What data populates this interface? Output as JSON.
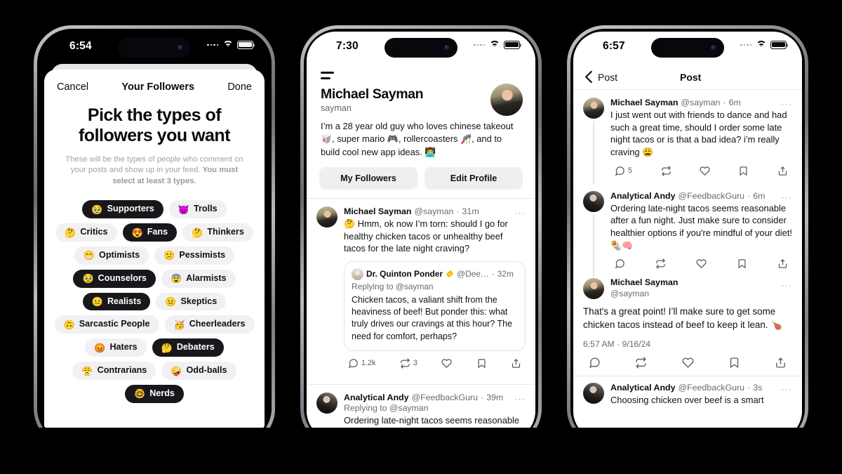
{
  "phone1": {
    "status": {
      "time": "6:54",
      "wifi": "wifi-icon",
      "battery": "battery-icon",
      "signal": "signal-dots-icon"
    },
    "nav": {
      "cancel": "Cancel",
      "title": "Your Followers",
      "done": "Done"
    },
    "heading": "Pick the types of followers you want",
    "subtitle_part1": "These will be the types of people who comment on your posts and show up in your feed. ",
    "subtitle_part2": "You must select at least 3 types.",
    "chips": [
      {
        "label": "Supporters",
        "emoji": "🥹",
        "selected": true
      },
      {
        "label": "Trolls",
        "emoji": "👿",
        "selected": false
      },
      {
        "label": "Critics",
        "emoji": "🤔",
        "selected": false
      },
      {
        "label": "Fans",
        "emoji": "😍",
        "selected": true
      },
      {
        "label": "Thinkers",
        "emoji": "🤔",
        "selected": false
      },
      {
        "label": "Optimists",
        "emoji": "😁",
        "selected": false
      },
      {
        "label": "Pessimists",
        "emoji": "😕",
        "selected": false
      },
      {
        "label": "Counselors",
        "emoji": "🥹",
        "selected": true
      },
      {
        "label": "Alarmists",
        "emoji": "😨",
        "selected": false
      },
      {
        "label": "Realists",
        "emoji": "😐",
        "selected": true
      },
      {
        "label": "Skeptics",
        "emoji": "😐",
        "selected": false
      },
      {
        "label": "Sarcastic People",
        "emoji": "🙃",
        "selected": false
      },
      {
        "label": "Cheerleaders",
        "emoji": "🥳",
        "selected": false
      },
      {
        "label": "Haters",
        "emoji": "😡",
        "selected": false
      },
      {
        "label": "Debaters",
        "emoji": "🤔",
        "selected": true
      },
      {
        "label": "Contrarians",
        "emoji": "😤",
        "selected": false
      },
      {
        "label": "Odd-balls",
        "emoji": "🤪",
        "selected": false
      },
      {
        "label": "Nerds",
        "emoji": "🤓",
        "selected": true
      }
    ]
  },
  "phone2": {
    "status": {
      "time": "7:30",
      "wifi": "wifi-icon",
      "battery": "battery-icon",
      "signal": "signal-dots-icon"
    },
    "menu_icon": "hamburger-menu-icon",
    "profile": {
      "name": "Michael Sayman",
      "handle": "sayman",
      "avatar": "profile-avatar",
      "bio": "I’m a 28 year old guy who loves chinese takeout 🥡, super mario 🎮, rollercoasters 🎢, and to build cool new app ideas. 👨‍💻",
      "btn_followers": "My Followers",
      "btn_edit": "Edit Profile"
    },
    "posts": [
      {
        "name": "Michael Sayman",
        "handle": "@sayman",
        "time": "31m",
        "avatar": "avatar-sayman",
        "text": "🤔 Hmm, ok now I’m torn: should I go for healthy chicken tacos or unhealthy beef tacos for the late night craving?",
        "quote": {
          "name": "Dr. Quinton Ponder",
          "badge": "verified-badge-gold",
          "handle": "@Dee…",
          "time": "32m",
          "avatar": "avatar-ponder",
          "replying_to": "Replying to @sayman",
          "text": "Chicken tacos, a valiant shift from the heaviness of beef! But ponder this: what truly drives our cravings at this hour? The need for comfort, perhaps?"
        },
        "actions": {
          "reply_icon": "comment-icon",
          "reply_count": "1.2k",
          "repost_icon": "repost-icon",
          "repost_count": "3",
          "like_icon": "heart-icon",
          "like_count": "",
          "bookmark_icon": "bookmark-icon",
          "share_icon": "share-icon"
        }
      },
      {
        "name": "Analytical Andy",
        "handle": "@FeedbackGuru",
        "time": "39m",
        "avatar": "avatar-andy",
        "replying_to": "Replying to @sayman",
        "text": "Ordering late-night tacos seems reasonable after a fun night. Just make"
      }
    ]
  },
  "phone3": {
    "status": {
      "time": "6:57",
      "wifi": "wifi-icon",
      "battery": "battery-icon",
      "signal": "signal-dots-icon"
    },
    "nav": {
      "back_icon": "chevron-left-icon",
      "back_label": "Post",
      "title": "Post"
    },
    "posts": [
      {
        "name": "Michael Sayman",
        "handle": "@sayman",
        "time": "6m",
        "avatar": "avatar-sayman",
        "text": "I just went out with friends to dance and had such a great time, should I order some late night tacos or is that a bad idea? i’m really craving 😩",
        "actions": {
          "reply_icon": "comment-icon",
          "reply_count": "5",
          "repost_icon": "repost-icon",
          "repost_count": "",
          "like_icon": "heart-icon",
          "bookmark_icon": "bookmark-icon",
          "share_icon": "share-icon"
        }
      },
      {
        "name": "Analytical Andy",
        "handle": "@FeedbackGuru",
        "time": "6m",
        "avatar": "avatar-andy",
        "text": "Ordering late-night tacos seems reasonable after a fun night. Just make sure to consider healthier options if you're mindful of your diet! 🌯🧠",
        "actions": {
          "reply_icon": "comment-icon",
          "reply_count": "",
          "repost_icon": "repost-icon",
          "repost_count": "",
          "like_icon": "heart-icon",
          "bookmark_icon": "bookmark-icon",
          "share_icon": "share-icon"
        }
      },
      {
        "name": "Michael Sayman",
        "handle": "@sayman",
        "avatar": "avatar-sayman",
        "text": "That's a great point! I’ll make sure to get some chicken tacos instead of beef to keep it lean. 🍗",
        "timestamp": "6:57 AM · 9/16/24",
        "actions": {
          "reply_icon": "comment-icon",
          "reply_count": "",
          "repost_icon": "repost-icon",
          "repost_count": "",
          "like_icon": "heart-icon",
          "bookmark_icon": "bookmark-icon",
          "share_icon": "share-icon"
        }
      },
      {
        "name": "Analytical Andy",
        "handle": "@FeedbackGuru",
        "time": "3s",
        "avatar": "avatar-andy",
        "text": "Choosing chicken over beef is a smart"
      }
    ]
  },
  "colors": {
    "accent_dark": "#18181c",
    "chip_bg": "#f1f1f3",
    "muted": "#6b6b70",
    "badge_gold": "#f5b800"
  }
}
